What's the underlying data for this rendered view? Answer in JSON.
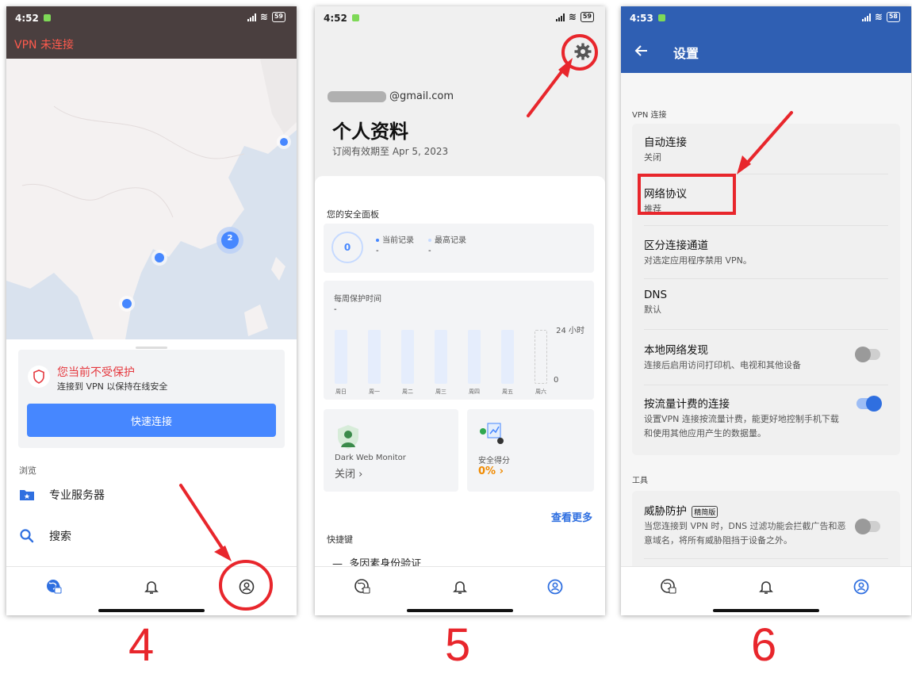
{
  "colors": {
    "accent": "#4687ff",
    "danger": "#e5393f",
    "annotation": "#e8262c",
    "header_blue": "#2f5fb3"
  },
  "steps": [
    "4",
    "5",
    "6"
  ],
  "phone4": {
    "status": {
      "time": "4:52",
      "battery": "59"
    },
    "title": "VPN 未连接",
    "map_badge": "2",
    "warning_title": "您当前不受保护",
    "warning_sub": "连接到 VPN 以保持在线安全",
    "quick_connect": "快速连接",
    "browse_label": "浏览",
    "items": [
      {
        "label": "专业服务器",
        "icon": "folder-star-icon"
      },
      {
        "label": "搜索",
        "icon": "search-icon"
      }
    ],
    "nav": [
      "globe-lock-icon",
      "bell-icon",
      "profile-icon"
    ]
  },
  "phone5": {
    "status": {
      "time": "4:52",
      "battery": "59"
    },
    "email_suffix": "@gmail.com",
    "title": "个人资料",
    "subtitle": "订阅有效期至 Apr 5, 2023",
    "dashboard_label": "您的安全面板",
    "score": "0",
    "current_label": "当前记录",
    "current_value": "-",
    "best_label": "最高记录",
    "best_value": "-",
    "weekly_label": "每周保护时间",
    "weekly_value": "-",
    "hours_label": "24 小时",
    "zero_label": "0",
    "days": [
      "周日",
      "周一",
      "周二",
      "周三",
      "周四",
      "周五",
      "周六"
    ],
    "monitor_title": "Dark Web Monitor",
    "monitor_status": "关闭",
    "score_title": "安全得分",
    "score_value": "0%",
    "see_more": "查看更多",
    "shortcuts_label": "快捷键",
    "shortcut_item": "多因素身份验证"
  },
  "phone6": {
    "status": {
      "time": "4:53",
      "battery": "58"
    },
    "title": "设置",
    "section_vpn": "VPN 连接",
    "rows": [
      {
        "title": "自动连接",
        "sub": "关闭"
      },
      {
        "title": "网络协议",
        "sub": "推荐"
      },
      {
        "title": "区分连接通道",
        "sub": "对选定应用程序禁用 VPN。"
      },
      {
        "title": "DNS",
        "sub": "默认"
      },
      {
        "title": "本地网络发现",
        "sub": "连接后启用访问打印机、电视和其他设备",
        "toggle": "off"
      },
      {
        "title": "按流量计费的连接",
        "sub": "设置VPN 连接按流量计费，能更好地控制手机下载和使用其他应用产生的数据量。",
        "toggle": "on"
      }
    ],
    "section_tools": "工具",
    "threat_title": "威胁防护",
    "threat_badge": "精简版",
    "threat_sub": "当您连接到 VPN 时，DNS 过滤功能会拦截广告和恶意域名，将所有威胁阻挡于设备之外。",
    "threat_toggle": "off"
  }
}
